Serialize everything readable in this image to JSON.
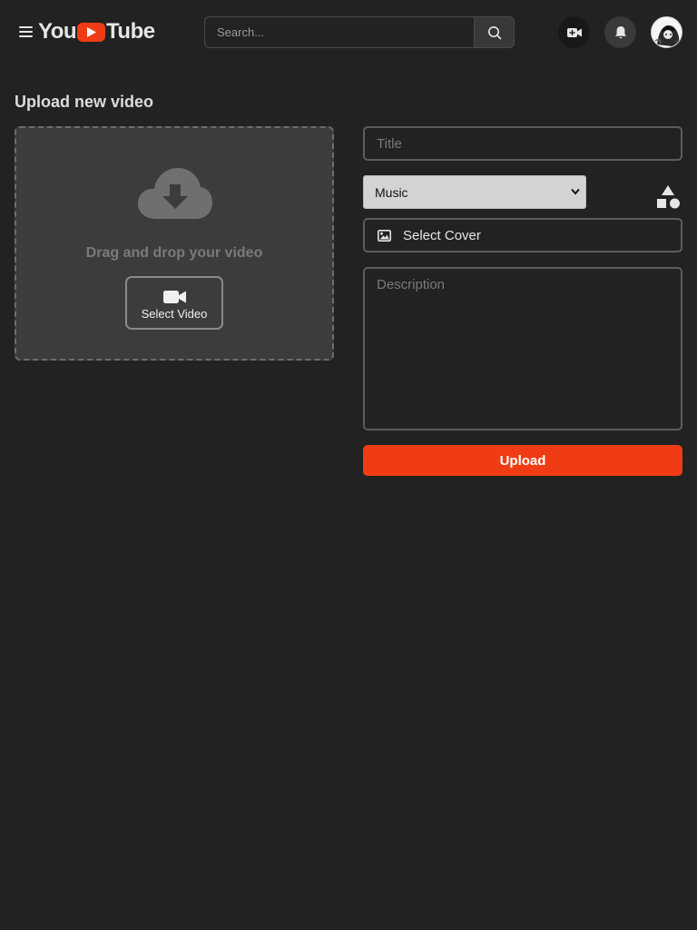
{
  "header": {
    "logo": {
      "text_left": "You",
      "text_right": "Tube",
      "accent": "#f03c14"
    },
    "search": {
      "placeholder": "Search..."
    },
    "icons": [
      "menu-icon",
      "search-icon",
      "video-plus-icon",
      "bell-icon",
      "avatar"
    ]
  },
  "page": {
    "title": "Upload new video"
  },
  "dropzone": {
    "text": "Drag and drop your video",
    "button_label": "Select Video",
    "icon": "cloud-download-icon"
  },
  "form": {
    "title_placeholder": "Title",
    "category_selected": "Music",
    "cover_label": "Select Cover",
    "description_placeholder": "Description",
    "upload_label": "Upload",
    "shapes_icon": "shapes-icon"
  },
  "colors": {
    "background": "#222222",
    "accent": "#f03c14",
    "dropzone_bg": "#3c3c3c",
    "border": "#5c5c5c"
  }
}
